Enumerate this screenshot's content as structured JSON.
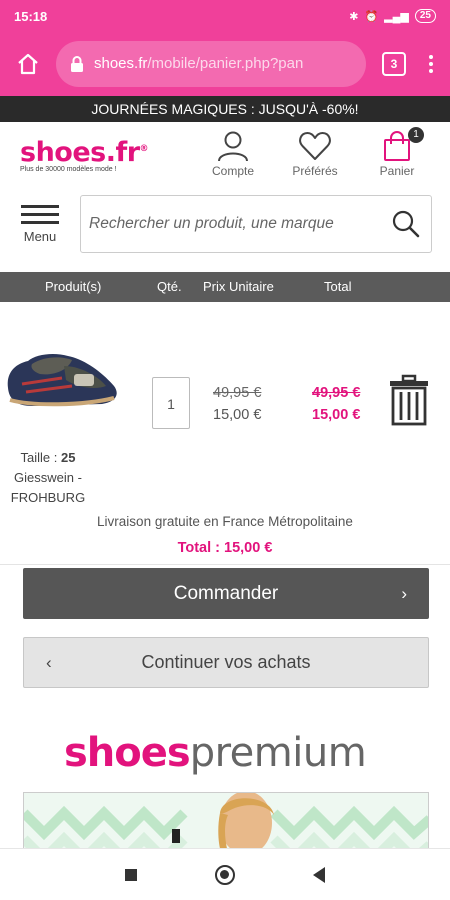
{
  "status_bar": {
    "time": "15:18",
    "signal": "4G",
    "battery": "25"
  },
  "browser": {
    "url_host": "shoes.fr",
    "url_path": "/mobile/panier.php?pan",
    "tab_count": "3"
  },
  "promo": {
    "text": "JOURNÉES MAGIQUES : JUSQU'À -60%!"
  },
  "header": {
    "logo_text": "shoes.fr",
    "logo_tagline": "Plus de 30000 modèles mode !",
    "account_label": "Compte",
    "favorites_label": "Préférés",
    "cart_label": "Panier",
    "cart_count": "1"
  },
  "menu": {
    "label": "Menu"
  },
  "search": {
    "placeholder": "Rechercher un produit, une marque"
  },
  "cart_table": {
    "headers": {
      "product": "Produit(s)",
      "qty": "Qté.",
      "unit_price": "Prix Unitaire",
      "total": "Total"
    }
  },
  "item": {
    "size_label": "Taille : ",
    "size_value": "25",
    "name": "Giesswein - FROHBURG",
    "quantity": "1",
    "unit_price_old": "49,95 €",
    "unit_price_new": "15,00 €",
    "total_old": "49,95 €",
    "total_new": "15,00 €"
  },
  "delivery_text": "Livraison gratuite en France Métropolitaine",
  "total_text": "Total : 15,00 €",
  "buttons": {
    "order": "Commander",
    "continue": "Continuer vos achats"
  },
  "premium": {
    "brand_a": "shoes",
    "brand_b": "premium"
  },
  "colors": {
    "brand_pink": "#e2137d",
    "status_pink": "#f0409a",
    "dark_button": "#565656"
  },
  "icons": [
    "home-icon",
    "lock-icon",
    "tabs-icon",
    "more-icon",
    "account-icon",
    "heart-icon",
    "bag-icon",
    "menu-icon",
    "search-icon",
    "trash-icon",
    "chevron-right-icon",
    "chevron-left-icon"
  ]
}
